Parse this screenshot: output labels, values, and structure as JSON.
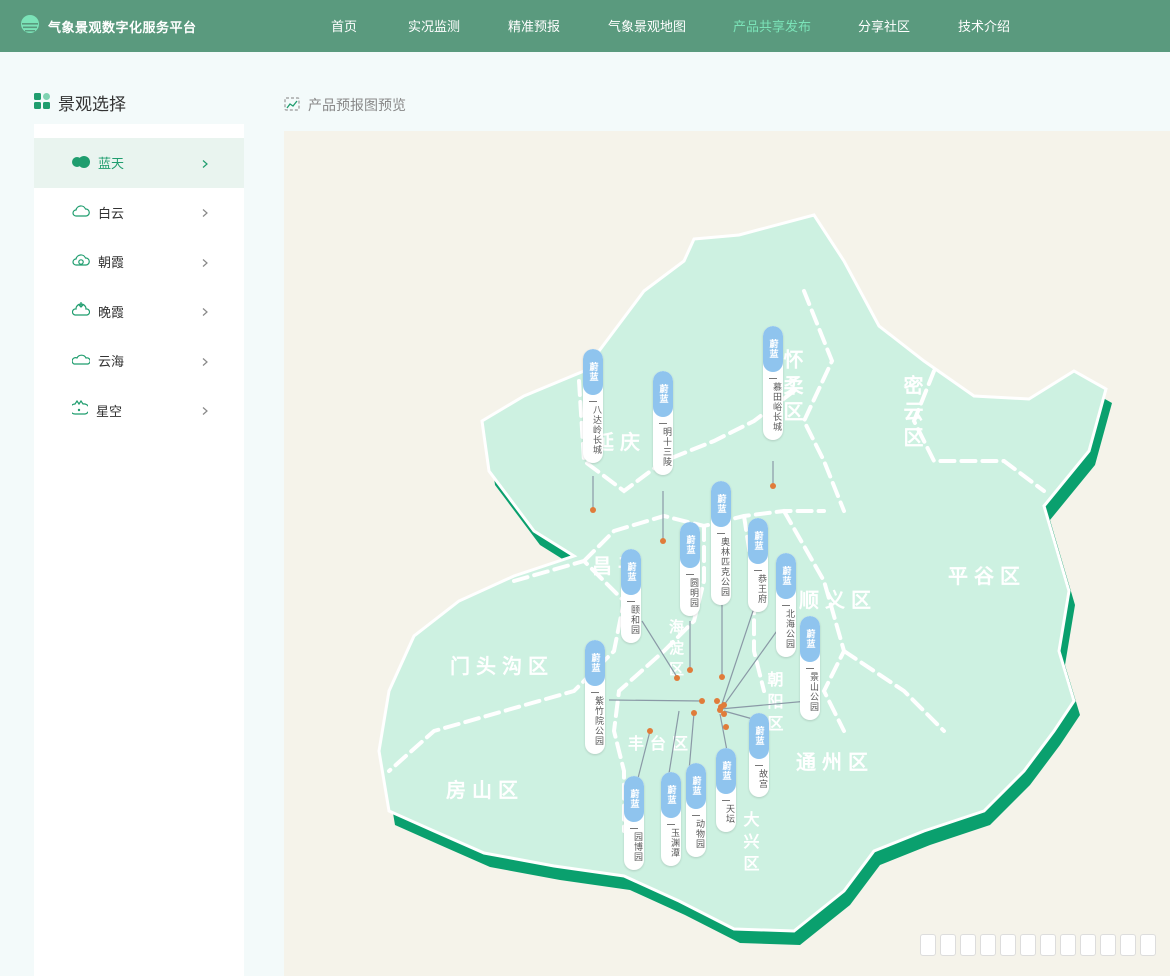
{
  "app": {
    "title": "气象景观数字化服务平台"
  },
  "nav": [
    {
      "label": "首页"
    },
    {
      "label": "实况监测"
    },
    {
      "label": "精准预报"
    },
    {
      "label": "气象景观地图"
    },
    {
      "label": "产品共享发布"
    },
    {
      "label": "分享社区"
    },
    {
      "label": "技术介绍"
    }
  ],
  "nav_active": 4,
  "sidebar": {
    "title": "景观选择",
    "items": [
      {
        "label": "蓝天",
        "icon": "blue-sky-icon"
      },
      {
        "label": "白云",
        "icon": "cloud-icon"
      },
      {
        "label": "朝霞",
        "icon": "sunrise-icon"
      },
      {
        "label": "晚霞",
        "icon": "sunset-icon"
      },
      {
        "label": "云海",
        "icon": "cloud-sea-icon"
      },
      {
        "label": "星空",
        "icon": "starry-sky-icon"
      }
    ],
    "active": 0
  },
  "main": {
    "title": "产品预报图预览"
  },
  "map": {
    "districts": [
      "怀柔区",
      "密云区",
      "延庆",
      "昌平",
      "平谷区",
      "顺义区",
      "门头沟区",
      "海淀区",
      "朝阳区",
      "丰台区",
      "通州区",
      "房山区",
      "大兴区"
    ],
    "forecast_value": "蔚蓝",
    "spots": [
      {
        "name": "八达岭长城",
        "value": "蔚蓝"
      },
      {
        "name": "明十三陵",
        "value": "蔚蓝"
      },
      {
        "name": "慕田峪长城",
        "value": "蔚蓝"
      },
      {
        "name": "奥林匹克公园",
        "value": "蔚蓝"
      },
      {
        "name": "圆明园",
        "value": "蔚蓝"
      },
      {
        "name": "恭王府",
        "value": "蔚蓝"
      },
      {
        "name": "颐和园",
        "value": "蔚蓝"
      },
      {
        "name": "北海公园",
        "value": "蔚蓝"
      },
      {
        "name": "景山公园",
        "value": "蔚蓝"
      },
      {
        "name": "紫竹院公园",
        "value": "蔚蓝"
      },
      {
        "name": "故宫",
        "value": "蔚蓝"
      },
      {
        "name": "天坛",
        "value": "蔚蓝"
      },
      {
        "name": "动物园",
        "value": "蔚蓝"
      },
      {
        "name": "玉渊潭",
        "value": "蔚蓝"
      },
      {
        "name": "园博园",
        "value": "蔚蓝"
      }
    ]
  },
  "colors": {
    "header_bg": "#5a9a7e",
    "accent": "#1f9d6e",
    "map_fill": "#cdf1e1",
    "map_edge": "#0aa06e",
    "tag_blue": "#8fc4ee",
    "dot": "#e07c3a"
  }
}
